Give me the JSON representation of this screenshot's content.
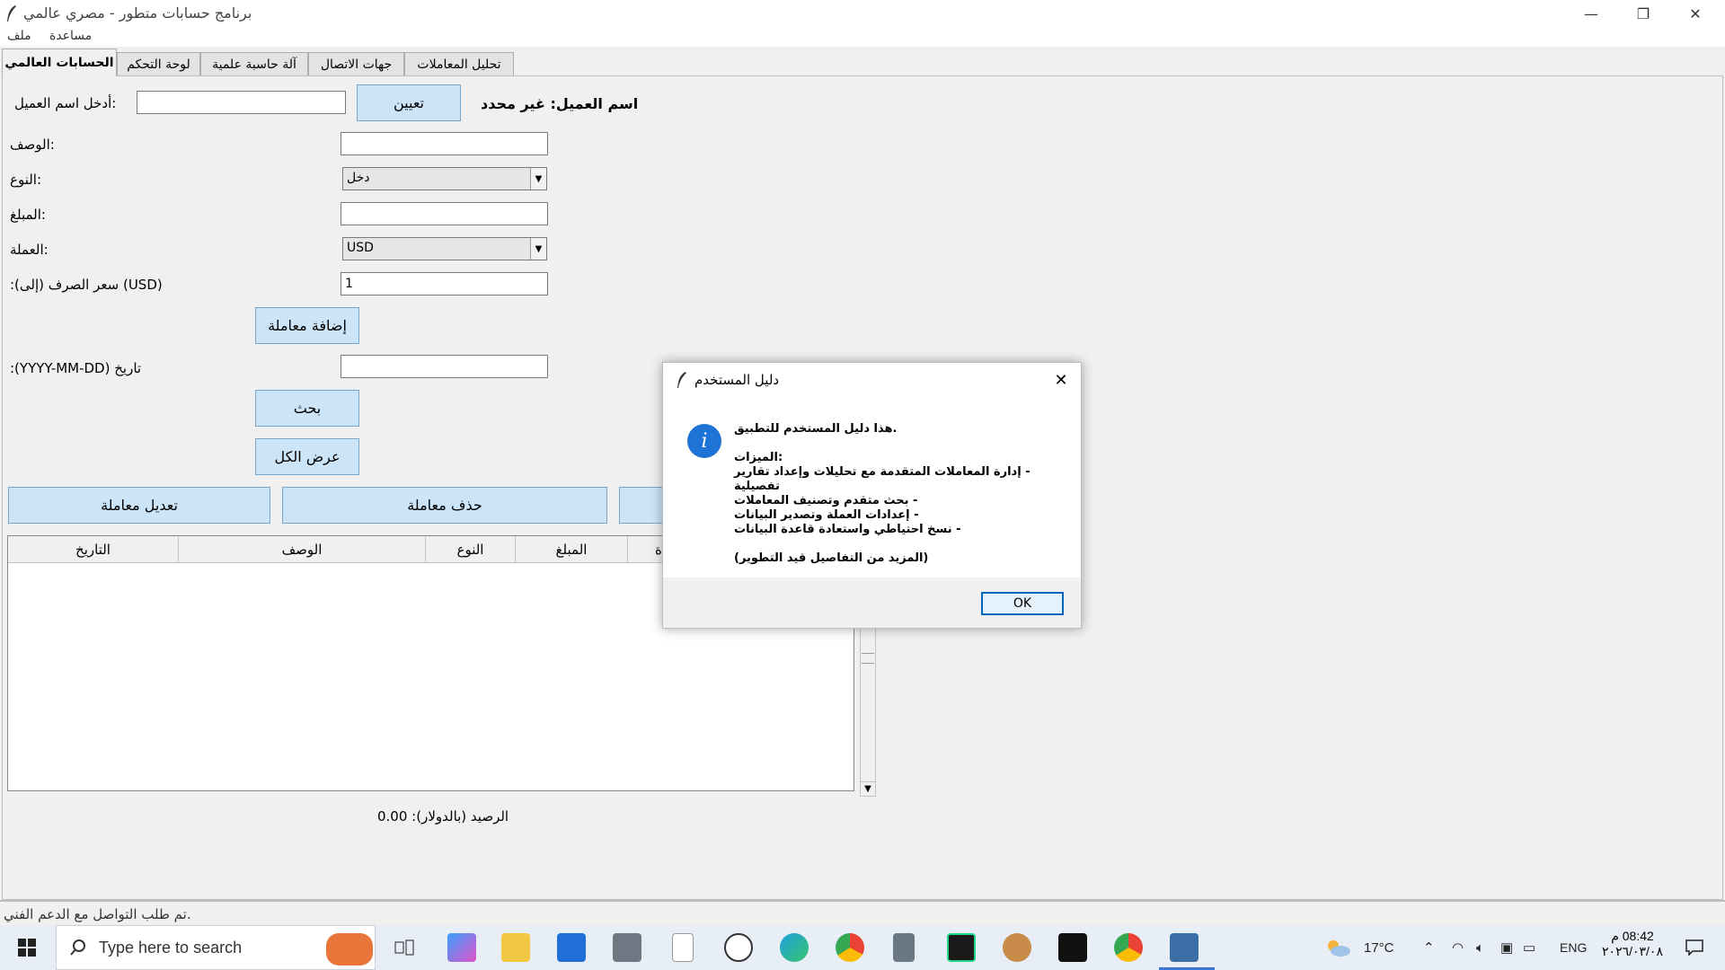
{
  "window": {
    "title": "برنامج حسابات متطور - مصري عالمي",
    "minimize": "—",
    "restore": "❐",
    "close": "✕"
  },
  "menu": {
    "file": "ملف",
    "help": "مساعدة"
  },
  "tabs": [
    "الحسابات العالمي",
    "لوحة التحكم",
    "آلة حاسبة علمية",
    "جهات الاتصال",
    "تحليل المعاملات"
  ],
  "form": {
    "client_name_label": ":أدخل اسم العميل",
    "client_name_value": "",
    "assign_button": "تعيين",
    "client_status": "اسم العميل: غير محدد",
    "description_label": ":الوصف",
    "description_value": "",
    "type_label": ":النوع",
    "type_value": "دخل",
    "amount_label": ":المبلغ",
    "amount_value": "",
    "currency_label": ":العملة",
    "currency_value": "USD",
    "rate_label": "(USD) سعر الصرف (إلى):",
    "rate_value": "1",
    "add_button": "إضافة معاملة",
    "date_label": "تاريخ (YYYY-MM-DD):",
    "date_value": "",
    "search_button": "بحث",
    "show_all_button": "عرض الكل",
    "edit_button": "تعديل معاملة",
    "delete_button": "حذف معاملة"
  },
  "table": {
    "columns": [
      "التاريخ",
      "الوصف",
      "النوع",
      "المبلغ",
      "ة"
    ]
  },
  "balance": "الرصيد (بالدولار): 0.00",
  "status": ".تم طلب التواصل مع الدعم الفني",
  "dialog": {
    "title": "دليل المستخدم",
    "close": "✕",
    "icon": "info-icon",
    "line1": ".هذا دليل المستخدم للتطبيق",
    "line2": ":الميزات",
    "line3": "- إدارة المعاملات المتقدمة مع تحليلات وإعداد تقارير تفصيلية",
    "line4": "- بحث متقدم وتصنيف المعاملات",
    "line5": "- إعدادات العملة وتصدير البيانات",
    "line6": "- نسخ احتياطي واستعادة قاعدة البيانات",
    "line7": "(المزيد من التفاصيل قيد التطوير)",
    "ok": "OK"
  },
  "taskbar": {
    "search_placeholder": "Type here to search",
    "weather": "17°C",
    "lang": "ENG",
    "time": "08:42 م",
    "date": "٢٠٢٦/٠٣/٠٨"
  }
}
